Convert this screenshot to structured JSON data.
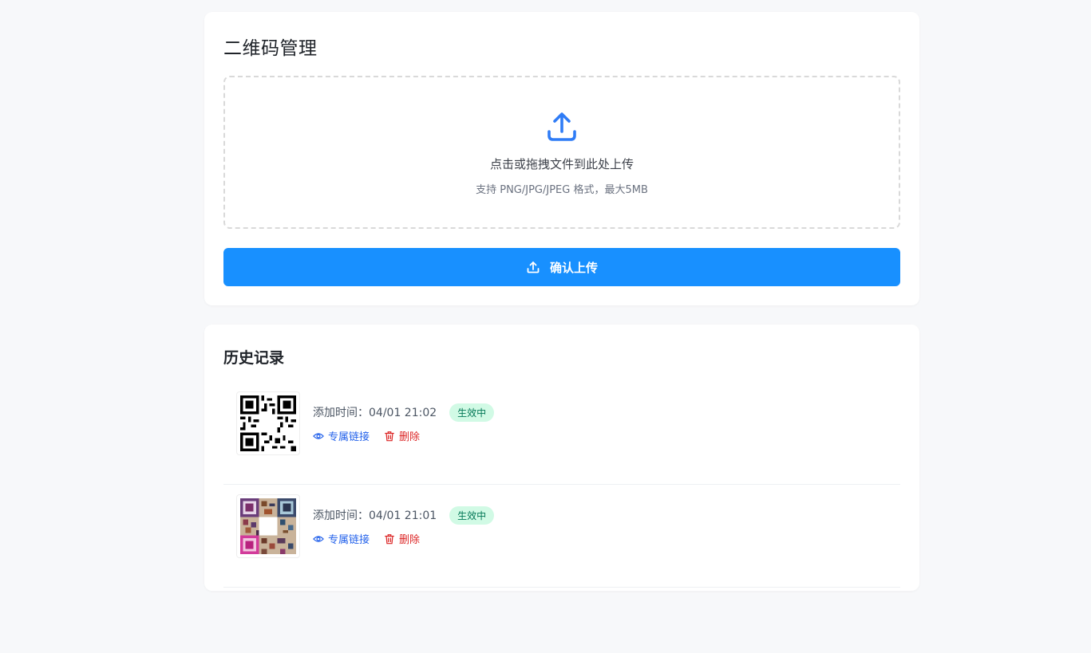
{
  "upload": {
    "title": "二维码管理",
    "dropzone_text": "点击或拖拽文件到此处上传",
    "dropzone_hint": "支持 PNG/JPG/JPEG 格式，最大5MB",
    "confirm_label": "确认上传",
    "upload_icon": "upload-icon"
  },
  "history": {
    "title": "历史记录",
    "items": [
      {
        "time": "添加时间：04/01 21:02",
        "status": "生效中",
        "view_label": "专属链接",
        "delete_label": "删除",
        "thumbnail": "qr-code-black"
      },
      {
        "time": "添加时间：04/01 21:01",
        "status": "生效中",
        "view_label": "专属链接",
        "delete_label": "删除",
        "thumbnail": "qr-code-colorful"
      }
    ]
  },
  "colors": {
    "primary": "#1890ff",
    "status_bg": "#d1fae5",
    "status_text": "#047857",
    "link": "#2563eb",
    "danger": "#dc2626"
  }
}
